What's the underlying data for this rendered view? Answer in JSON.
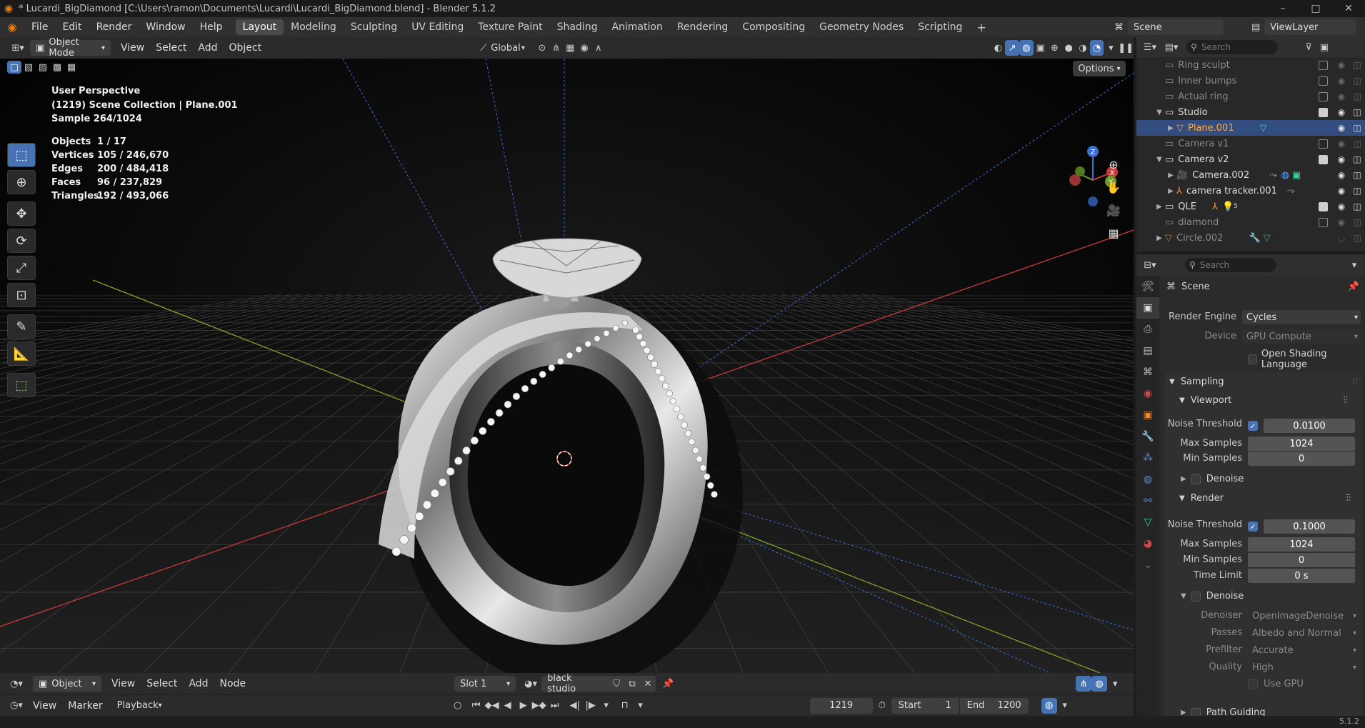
{
  "window": {
    "title": "* Lucardi_BigDiamond [C:\\Users\\ramon\\Documents\\Lucardi\\Lucardi_BigDiamond.blend] - Blender 5.1.2",
    "minimize": "–",
    "maximize": "□",
    "close": "✕"
  },
  "menu": {
    "items": [
      "File",
      "Edit",
      "Render",
      "Window",
      "Help"
    ]
  },
  "workspaces": {
    "tabs": [
      "Layout",
      "Modeling",
      "Sculpting",
      "UV Editing",
      "Texture Paint",
      "Shading",
      "Animation",
      "Rendering",
      "Compositing",
      "Geometry Nodes",
      "Scripting"
    ],
    "active": "Layout",
    "add": "+"
  },
  "topright": {
    "scene": "Scene",
    "view_layer": "ViewLayer"
  },
  "viewport_header": {
    "mode": "Object Mode",
    "menus": [
      "View",
      "Select",
      "Add",
      "Object"
    ],
    "orientation": "Global"
  },
  "viewport": {
    "view_name": "User Perspective",
    "collection": "(1219) Scene Collection | Plane.001",
    "sample": "Sample 264/1024",
    "options": "Options",
    "stats": [
      {
        "label": "Objects",
        "value": "1 / 17"
      },
      {
        "label": "Vertices",
        "value": "105 / 246,670"
      },
      {
        "label": "Edges",
        "value": "200 / 484,418"
      },
      {
        "label": "Faces",
        "value": "96 / 237,829"
      },
      {
        "label": "Triangles",
        "value": "192 / 493,066"
      }
    ],
    "gizmo": {
      "z": "Z",
      "x": "X",
      "y": "Y"
    }
  },
  "outliner": {
    "search_placeholder": "Search",
    "rows": [
      {
        "label": "Ring sculpt",
        "dim": true
      },
      {
        "label": "Inner bumps",
        "dim": true
      },
      {
        "label": "Actual ring",
        "dim": true
      },
      {
        "label": "Studio",
        "dim": false
      },
      {
        "label": "Plane.001",
        "dim": false
      },
      {
        "label": "Camera v1",
        "dim": true
      },
      {
        "label": "Camera v2",
        "dim": false
      },
      {
        "label": "Camera.002",
        "dim": false
      },
      {
        "label": "camera tracker.001",
        "dim": false
      },
      {
        "label": "QLE",
        "dim": false,
        "badge": "5"
      },
      {
        "label": "diamond",
        "dim": true
      },
      {
        "label": "Circle.002",
        "dim": true
      }
    ]
  },
  "properties": {
    "search_placeholder": "Search",
    "context": "Scene",
    "render_engine_label": "Render Engine",
    "render_engine": "Cycles",
    "device_label": "Device",
    "device": "GPU Compute",
    "osl": "Open Shading Language",
    "sampling": "Sampling",
    "viewport": {
      "title": "Viewport",
      "noise_threshold_label": "Noise Threshold",
      "noise_threshold": "0.0100",
      "max_samples_label": "Max Samples",
      "max_samples": "1024",
      "min_samples_label": "Min Samples",
      "min_samples": "0",
      "denoise": "Denoise"
    },
    "render": {
      "title": "Render",
      "noise_threshold_label": "Noise Threshold",
      "noise_threshold": "0.1000",
      "max_samples_label": "Max Samples",
      "max_samples": "1024",
      "min_samples_label": "Min Samples",
      "min_samples": "0",
      "time_limit_label": "Time Limit",
      "time_limit": "0 s",
      "denoise": "Denoise",
      "denoiser_label": "Denoiser",
      "denoiser": "OpenImageDenoise",
      "passes_label": "Passes",
      "passes": "Albedo and Normal",
      "prefilter_label": "Prefilter",
      "prefilter": "Accurate",
      "quality_label": "Quality",
      "quality": "High",
      "use_gpu": "Use GPU"
    },
    "path_guiding": "Path Guiding"
  },
  "shader_header": {
    "mode": "Object",
    "menus": [
      "View",
      "Select",
      "Add",
      "Node"
    ],
    "slot": "Slot 1",
    "material": "black studio"
  },
  "timeline": {
    "menus": [
      "View",
      "Marker"
    ],
    "playback": "Playback",
    "current_frame": "1219",
    "start_label": "Start",
    "start": "1",
    "end_label": "End",
    "end": "1200"
  },
  "status": {
    "version": "5.1.2"
  }
}
